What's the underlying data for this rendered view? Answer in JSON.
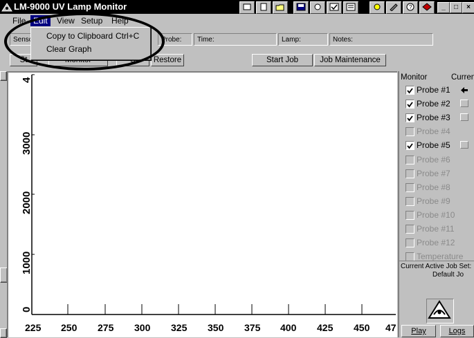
{
  "window": {
    "title": "LM-9000 UV Lamp Monitor",
    "controls": {
      "minimize": "_",
      "maximize": "□",
      "close": "×"
    }
  },
  "menubar": {
    "items": [
      {
        "label": "File"
      },
      {
        "label": "Edit"
      },
      {
        "label": "View"
      },
      {
        "label": "Setup"
      },
      {
        "label": "Help"
      }
    ]
  },
  "edit_menu": {
    "items": [
      {
        "label": "Copy to Clipboard",
        "shortcut": "Ctrl+C"
      },
      {
        "label": "Clear Graph",
        "shortcut": ""
      }
    ]
  },
  "info_row": {
    "sensor": "Sensc",
    "probe": "Probe:",
    "time": "Time:",
    "lamp": "Lamp:",
    "notes": "Notes:"
  },
  "buttons": {
    "left_a": "St",
    "monitor": "Monitor",
    "save": "S",
    "restore": "Restore",
    "start_job": "Start Job",
    "job_maintenance": "Job Maintenance"
  },
  "graph": {
    "y_ticks": [
      "4",
      "3000",
      "2000",
      "1000",
      "0"
    ],
    "x_ticks": [
      "225",
      "250",
      "275",
      "300",
      "325",
      "350",
      "375",
      "400",
      "425",
      "450",
      "47"
    ]
  },
  "right_panel": {
    "monitor_header": "Monitor",
    "current_header": "Curren",
    "probes": [
      {
        "label": "Probe #1",
        "checked": true,
        "enabled": true,
        "current": "arrow"
      },
      {
        "label": "Probe #2",
        "checked": true,
        "enabled": true,
        "current": "box"
      },
      {
        "label": "Probe #3",
        "checked": true,
        "enabled": true,
        "current": "box"
      },
      {
        "label": "Probe #4",
        "checked": false,
        "enabled": false,
        "current": ""
      },
      {
        "label": "Probe #5",
        "checked": true,
        "enabled": true,
        "current": "box"
      },
      {
        "label": "Probe #6",
        "checked": false,
        "enabled": false,
        "current": ""
      },
      {
        "label": "Probe #7",
        "checked": false,
        "enabled": false,
        "current": ""
      },
      {
        "label": "Probe #8",
        "checked": false,
        "enabled": false,
        "current": ""
      },
      {
        "label": "Probe #9",
        "checked": false,
        "enabled": false,
        "current": ""
      },
      {
        "label": "Probe #10",
        "checked": false,
        "enabled": false,
        "current": ""
      },
      {
        "label": "Probe #11",
        "checked": false,
        "enabled": false,
        "current": ""
      },
      {
        "label": "Probe #12",
        "checked": false,
        "enabled": false,
        "current": ""
      },
      {
        "label": "Temperature",
        "checked": false,
        "enabled": false,
        "current": ""
      }
    ],
    "job_set_label": "Current Active Job Set:",
    "job_set_value": "Default Jo",
    "play_button": "Play",
    "logs_button": "Logs"
  },
  "colors": {
    "titlebar": "#000000",
    "menu_highlight": "#000080",
    "face": "#c0c0c0",
    "plot_bg": "#ffffff"
  }
}
